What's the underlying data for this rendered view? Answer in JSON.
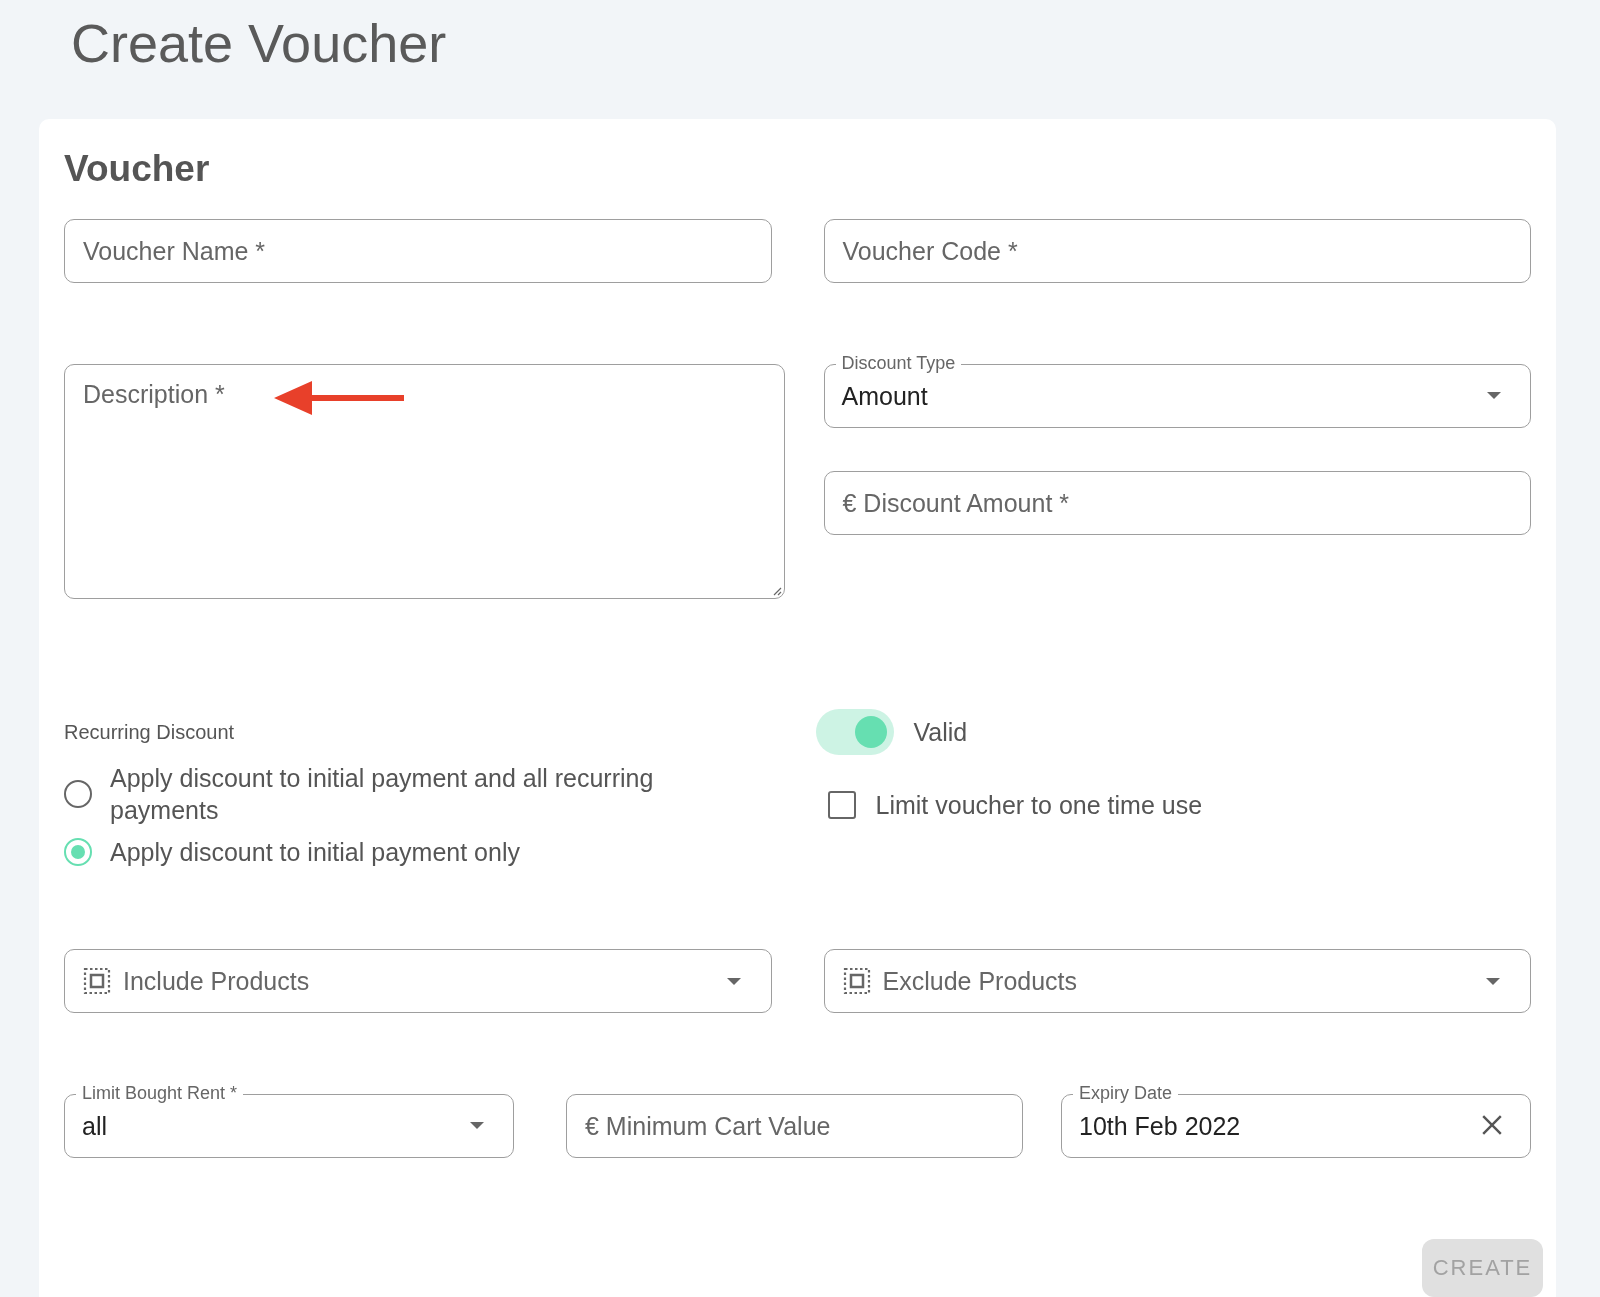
{
  "page_title": "Create Voucher",
  "card": {
    "heading": "Voucher",
    "top_left": [
      {
        "kind": "text",
        "label": "Voucher Name *"
      },
      {
        "kind": "textarea",
        "label": "Description *"
      }
    ],
    "top_right": [
      {
        "kind": "text",
        "label": "Voucher Code *"
      },
      {
        "kind": "select",
        "label": "Discount Type",
        "value": "Amount"
      },
      {
        "kind": "text",
        "label": "€ Discount Amount *"
      }
    ],
    "recurring": {
      "label": "Recurring Discount",
      "options": [
        {
          "label": "Apply discount to initial payment and all recurring payments",
          "selected": false
        },
        {
          "label": "Apply discount to initial payment only",
          "selected": true
        }
      ]
    },
    "valid_toggle": {
      "label": "Valid",
      "on": true
    },
    "one_time_checkbox": {
      "label": "Limit voucher to one time use",
      "checked": false
    },
    "product_fields": [
      {
        "kind": "products",
        "label": "Include Products"
      },
      {
        "kind": "products",
        "label": "Exclude Products"
      }
    ],
    "bottom_fields": [
      {
        "kind": "select",
        "label": "Limit Bought Rent *",
        "value": "all"
      },
      {
        "kind": "text",
        "label": "€ Minimum Cart Value"
      },
      {
        "kind": "date",
        "label": "Expiry Date",
        "value": "10th Feb 2022"
      }
    ],
    "create_button": {
      "label": "CREATE",
      "disabled": true
    }
  }
}
